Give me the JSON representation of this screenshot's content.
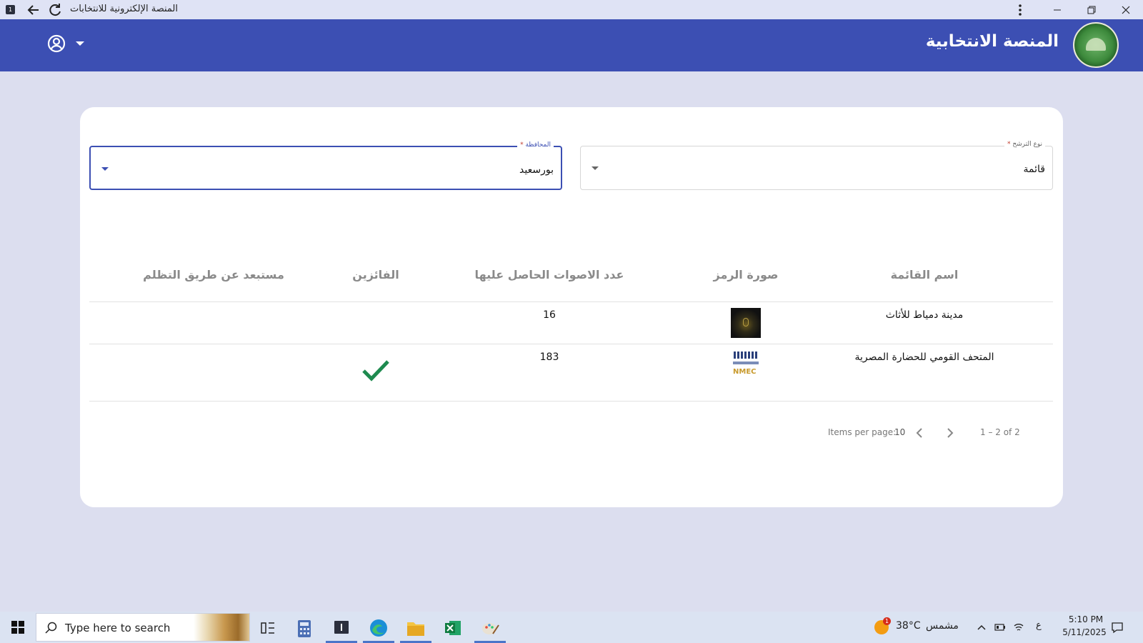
{
  "window": {
    "title": "المنصة الإلكترونية للانتخابات",
    "app_icon_label": "1"
  },
  "header": {
    "title": "المنصة الانتخابية"
  },
  "filters": {
    "candidacy_type": {
      "label": "نوع الترشح",
      "required_mark": "*",
      "value": "قائمة"
    },
    "governorate": {
      "label": "المحافظة",
      "required_mark": "*",
      "value": "بورسعيد"
    }
  },
  "table": {
    "columns": [
      "اسم القائمة",
      "صورة الرمز",
      "عدد الاصوات الحاصل عليها",
      "الفائزين",
      "مستبعد عن طريق التظلم"
    ],
    "rows": [
      {
        "name": "مدينة دمياط للأثاث",
        "votes": "16",
        "winner": false,
        "symbol": "dark-emblem-logo"
      },
      {
        "name": "المتحف القومي للحضارة المصرية",
        "votes": "183",
        "winner": true,
        "symbol": "nmec-logo",
        "symbol_text": "NMEC"
      }
    ]
  },
  "paginator": {
    "items_per_page_label": "Items per page:",
    "page_size": "10",
    "range_label": "1 – 2 of 2"
  },
  "taskbar": {
    "search_placeholder": "Type here to search",
    "weather_badge": "1",
    "temperature": "38°C",
    "condition": "مشمس",
    "language": "ع",
    "time": "5:10 PM",
    "date": "5/11/2025"
  },
  "colors": {
    "primary": "#3c4fb3",
    "background": "#dcdeef",
    "winner_check": "#1e8a4f"
  }
}
